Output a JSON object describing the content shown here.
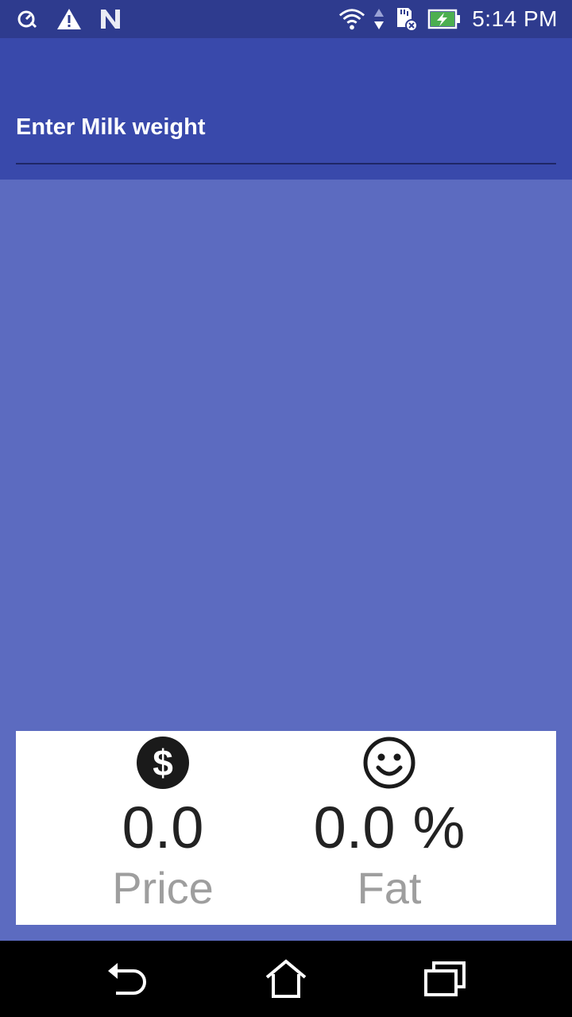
{
  "status_bar": {
    "time": "5:14 PM",
    "icons": [
      "speedometer-icon",
      "warning-icon",
      "n-icon",
      "wifi-icon",
      "data-arrows-icon",
      "sd-card-icon",
      "battery-charging-icon"
    ]
  },
  "header": {
    "input_placeholder": "Enter Milk weight"
  },
  "results": {
    "price": {
      "icon": "dollar-icon",
      "value": "0.0",
      "label": "Price"
    },
    "fat": {
      "icon": "smiley-icon",
      "value": "0.0",
      "unit": "%",
      "label": "Fat"
    }
  },
  "nav": {
    "icons": [
      "back-icon",
      "home-icon",
      "recents-icon"
    ]
  },
  "colors": {
    "status_bar": "#2e3b8e",
    "header": "#3949ab",
    "background": "#5c6bc0",
    "card": "#ffffff"
  }
}
